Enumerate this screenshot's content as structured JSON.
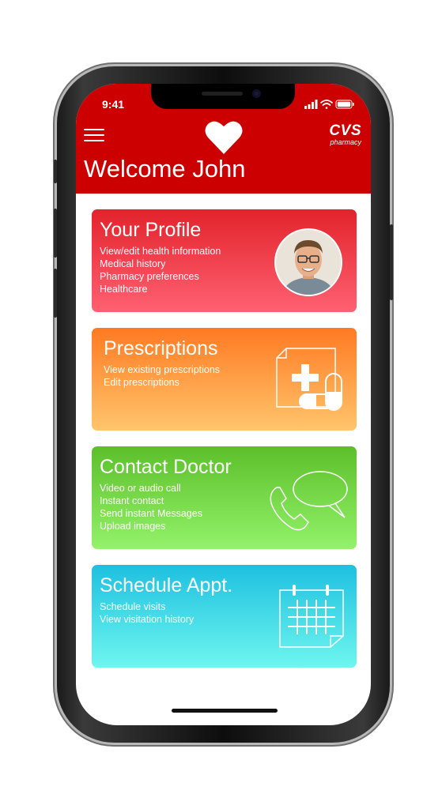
{
  "status_bar": {
    "time": "9:41"
  },
  "header": {
    "welcome": "Welcome John",
    "logo_text": "CVS",
    "logo_subtext": "pharmacy",
    "heart_icon": "heart-icon",
    "menu_icon": "hamburger-menu-icon"
  },
  "cards": [
    {
      "title": "Your Profile",
      "lines": [
        "View/edit health information",
        "Medical history",
        "Pharmacy preferences",
        "Healthcare"
      ],
      "icon": "avatar"
    },
    {
      "title": "Prescriptions",
      "lines": [
        "View existing prescriptions",
        "Edit prescriptions"
      ],
      "icon": "prescription-icon"
    },
    {
      "title": "Contact Doctor",
      "lines": [
        "Video or audio call",
        "Instant contact",
        "Send instant Messages",
        "Upload images"
      ],
      "icon": "phone-chat-icon"
    },
    {
      "title": "Schedule Appt.",
      "lines": [
        "Schedule visits",
        "View visitation history"
      ],
      "icon": "calendar-icon"
    }
  ],
  "colors": {
    "header": "#cc0000",
    "profile": "#e2232b",
    "prescriptions": "#ff7a22",
    "doctor": "#5cbf2a",
    "appointment": "#1ec0e0"
  }
}
